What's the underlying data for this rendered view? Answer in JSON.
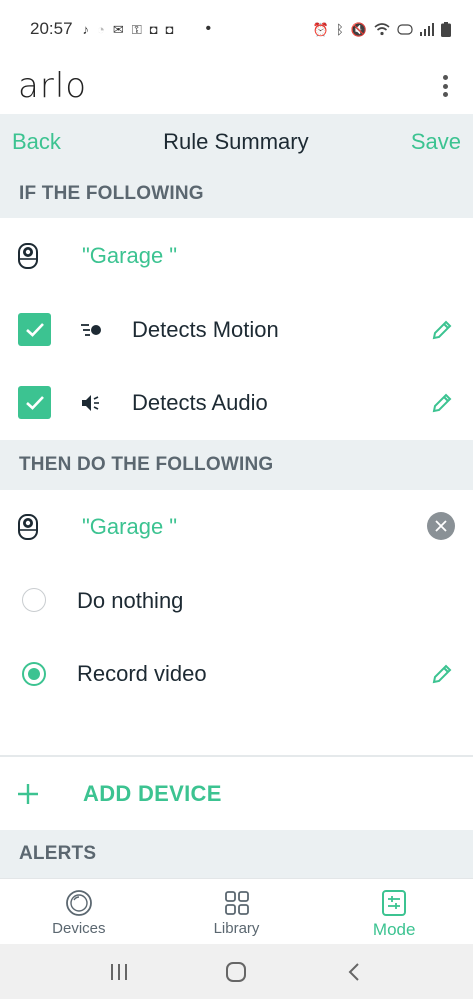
{
  "status_bar": {
    "time": "20:57",
    "left_icons": [
      "tiktok-icon",
      "clock-icon",
      "mail-icon",
      "key-icon",
      "instagram-icon",
      "instagram-icon"
    ],
    "right_icons": [
      "alarm-icon",
      "bluetooth-icon",
      "mute-icon",
      "wifi-icon",
      "volte-icon",
      "signal-icon",
      "battery-icon"
    ],
    "dot": "•"
  },
  "app_bar": {
    "logo": "arlo"
  },
  "nav_header": {
    "back_label": "Back",
    "title": "Rule Summary",
    "save_label": "Save"
  },
  "if_section": {
    "header": "IF THE FOLLOWING",
    "device_name": "\"Garage \"",
    "triggers": [
      {
        "label": "Detects Motion",
        "checked": true,
        "icon": "motion-icon"
      },
      {
        "label": "Detects Audio",
        "checked": true,
        "icon": "audio-icon"
      }
    ]
  },
  "then_section": {
    "header": "THEN DO THE FOLLOWING",
    "device_name": "\"Garage \"",
    "actions": [
      {
        "label": "Do nothing",
        "selected": false
      },
      {
        "label": "Record video",
        "selected": true
      }
    ]
  },
  "add_device": {
    "label": "ADD DEVICE"
  },
  "alerts_section": {
    "header": "ALERTS"
  },
  "bottom_nav": {
    "items": [
      {
        "label": "Devices",
        "icon": "devices-icon",
        "active": false
      },
      {
        "label": "Library",
        "icon": "library-icon",
        "active": false
      },
      {
        "label": "Mode",
        "icon": "mode-icon",
        "active": true
      }
    ]
  },
  "colors": {
    "accent": "#3cc391",
    "section_bg": "#ebf0f2",
    "text_dark": "#1d2a33",
    "text_muted": "#5b6770"
  }
}
